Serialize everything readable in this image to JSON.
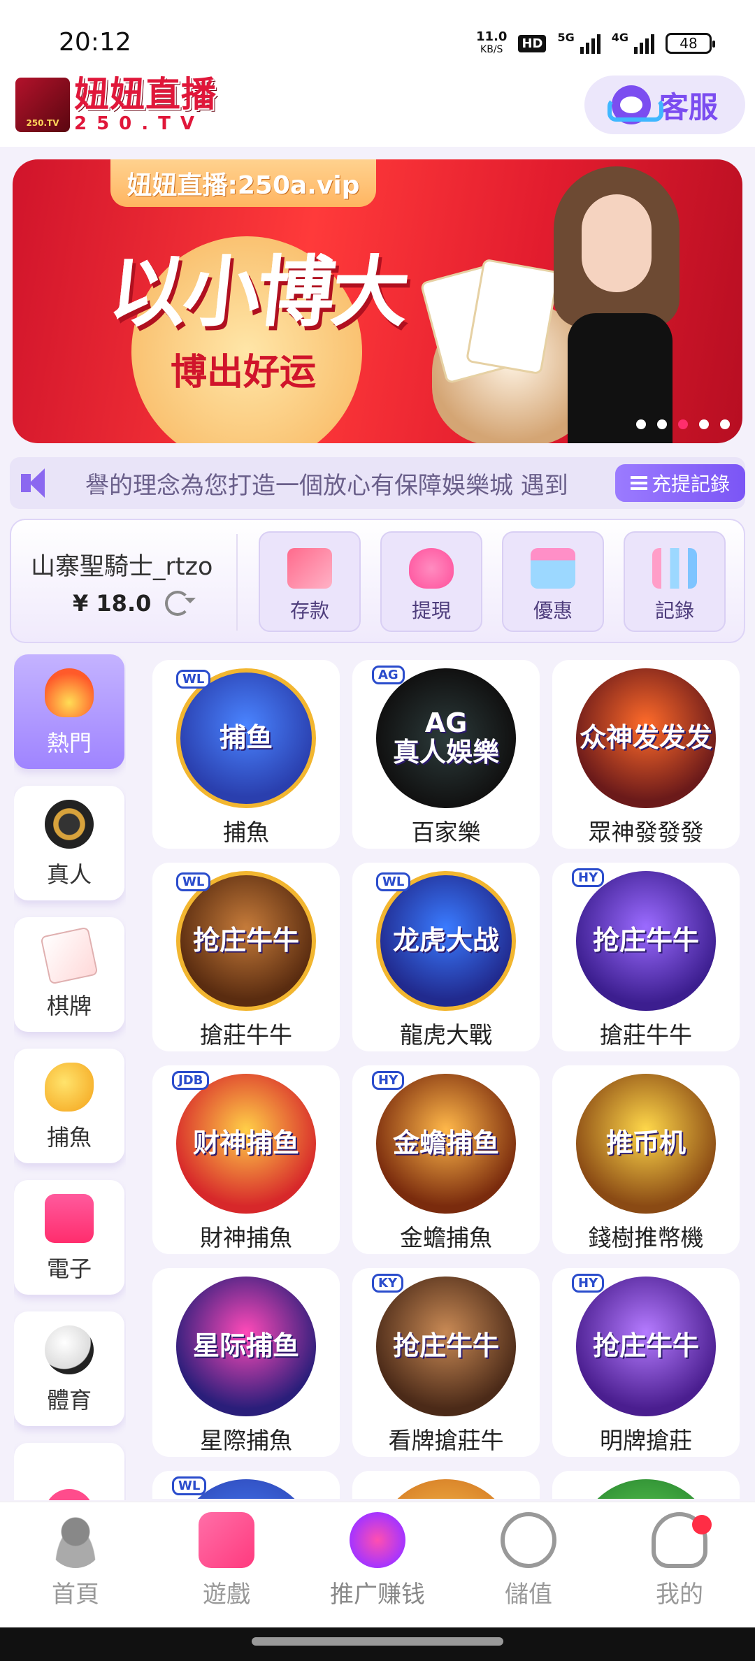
{
  "status_bar": {
    "time": "20:12",
    "net_speed": "11.0",
    "net_unit": "KB/S",
    "hd": "HD",
    "signal1": "5G",
    "signal2": "4G",
    "battery": "48"
  },
  "header": {
    "logo_cn": "妞妞直播",
    "logo_en": "250.TV",
    "logo_badge": "250.TV",
    "service_label": "客服"
  },
  "banner": {
    "tag": "妞妞直播:250a.vip",
    "title": "以小博大",
    "subtitle": "博出好运",
    "dot_count": 5,
    "active_dot": 3
  },
  "marquee": {
    "text": "譽的理念為您打造一個放心有保障娛樂城 遇到",
    "records_label": "充提記錄"
  },
  "account": {
    "username": "山寨聖騎士_rtzo",
    "balance": "¥ 18.0",
    "actions": [
      {
        "label": "存款",
        "icon": "deposit-card-icon"
      },
      {
        "label": "提現",
        "icon": "withdraw-bag-icon"
      },
      {
        "label": "優惠",
        "icon": "gift-box-icon"
      },
      {
        "label": "記錄",
        "icon": "bar-chart-icon"
      }
    ]
  },
  "categories": [
    {
      "label": "熱門",
      "icon": "fire-icon",
      "active": true
    },
    {
      "label": "真人",
      "icon": "casino-chip-icon"
    },
    {
      "label": "棋牌",
      "icon": "playing-card-icon"
    },
    {
      "label": "捕魚",
      "icon": "fish-icon"
    },
    {
      "label": "電子",
      "icon": "slot-machine-icon"
    },
    {
      "label": "體育",
      "icon": "soccer-ball-icon"
    },
    {
      "label": "",
      "icon": "lottery-ball-icon"
    }
  ],
  "games": [
    {
      "name": "捕魚",
      "provider": "WL",
      "thumb_text": "捕鱼"
    },
    {
      "name": "百家樂",
      "provider": "AG",
      "thumb_text": "AG\n真人娛樂"
    },
    {
      "name": "眾神發發發",
      "provider": "",
      "thumb_text": "众神发发发"
    },
    {
      "name": "搶莊牛牛",
      "provider": "WL",
      "thumb_text": "抢庄牛牛"
    },
    {
      "name": "龍虎大戰",
      "provider": "WL",
      "thumb_text": "龙虎大战"
    },
    {
      "name": "搶莊牛牛",
      "provider": "HY",
      "thumb_text": "抢庄牛牛"
    },
    {
      "name": "財神捕魚",
      "provider": "JDB",
      "thumb_text": "财神捕鱼"
    },
    {
      "name": "金蟾捕魚",
      "provider": "HY",
      "thumb_text": "金蟾捕鱼"
    },
    {
      "name": "錢樹推幣機",
      "provider": "",
      "thumb_text": "推币机"
    },
    {
      "name": "星際捕魚",
      "provider": "",
      "thumb_text": "星际捕鱼"
    },
    {
      "name": "看牌搶莊牛",
      "provider": "KY",
      "thumb_text": "抢庄牛牛"
    },
    {
      "name": "明牌搶莊",
      "provider": "HY",
      "thumb_text": "抢庄牛牛"
    },
    {
      "name": "",
      "provider": "WL",
      "thumb_text": ""
    },
    {
      "name": "",
      "provider": "",
      "thumb_text": ""
    },
    {
      "name": "",
      "provider": "",
      "thumb_text": ""
    }
  ],
  "bottom_nav": [
    {
      "label": "首頁",
      "icon": "home-avatar-icon"
    },
    {
      "label": "遊戲",
      "icon": "gamepad-icon"
    },
    {
      "label": "推广赚钱",
      "icon": "promo-earn-icon"
    },
    {
      "label": "儲值",
      "icon": "yen-plus-icon"
    },
    {
      "label": "我的",
      "icon": "user-icon"
    }
  ]
}
